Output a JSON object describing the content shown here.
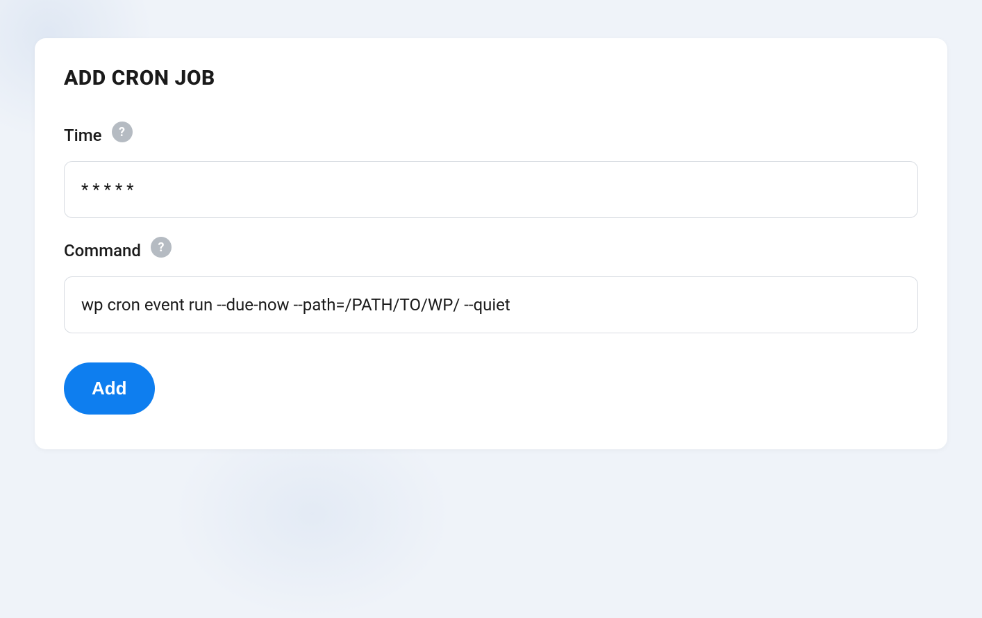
{
  "card": {
    "title": "ADD CRON JOB"
  },
  "form": {
    "time": {
      "label": "Time",
      "value": "* * * * *",
      "help_icon": "?"
    },
    "command": {
      "label": "Command",
      "value": "wp cron event run --due-now --path=/PATH/TO/WP/ --quiet",
      "help_icon": "?"
    },
    "submit_label": "Add"
  }
}
